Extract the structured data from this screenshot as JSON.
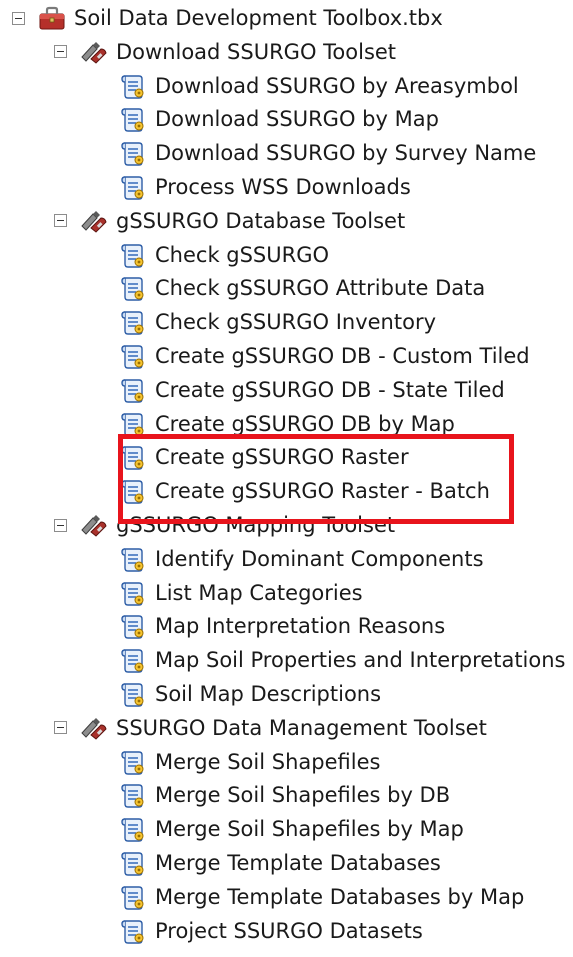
{
  "toolbox": {
    "label": "Soil Data Development Toolbox.tbx",
    "icon": "toolbox-icon"
  },
  "toolsets": [
    {
      "label": "Download SSURGO Toolset",
      "icon": "toolset-icon",
      "tools": [
        "Download SSURGO by Areasymbol",
        "Download SSURGO by Map",
        "Download SSURGO by Survey Name",
        "Process WSS Downloads"
      ]
    },
    {
      "label": "gSSURGO Database Toolset",
      "icon": "toolset-icon",
      "tools": [
        "Check gSSURGO",
        "Check gSSURGO Attribute Data",
        "Check gSSURGO Inventory",
        "Create gSSURGO DB - Custom Tiled",
        "Create gSSURGO DB - State Tiled",
        "Create gSSURGO DB by Map",
        "Create gSSURGO Raster",
        "Create gSSURGO Raster - Batch"
      ]
    },
    {
      "label": "gSSURGO Mapping Toolset",
      "icon": "toolset-icon",
      "tools": [
        "Identify Dominant Components",
        "List Map Categories",
        "Map Interpretation Reasons",
        "Map Soil Properties and Interpretations",
        "Soil Map Descriptions"
      ]
    },
    {
      "label": "SSURGO Data Management Toolset",
      "icon": "toolset-icon",
      "tools": [
        "Merge Soil Shapefiles",
        "Merge Soil Shapefiles by DB",
        "Merge Soil Shapefiles by Map",
        "Merge Template Databases",
        "Merge Template Databases by Map",
        "Project SSURGO Datasets"
      ]
    }
  ],
  "tool_icon": "script-tool-icon",
  "collapse_icon": "collapse-minus-icon",
  "highlight": {
    "color": "#e8141c",
    "tools": [
      "Create gSSURGO Raster",
      "Create gSSURGO Raster - Batch"
    ]
  }
}
